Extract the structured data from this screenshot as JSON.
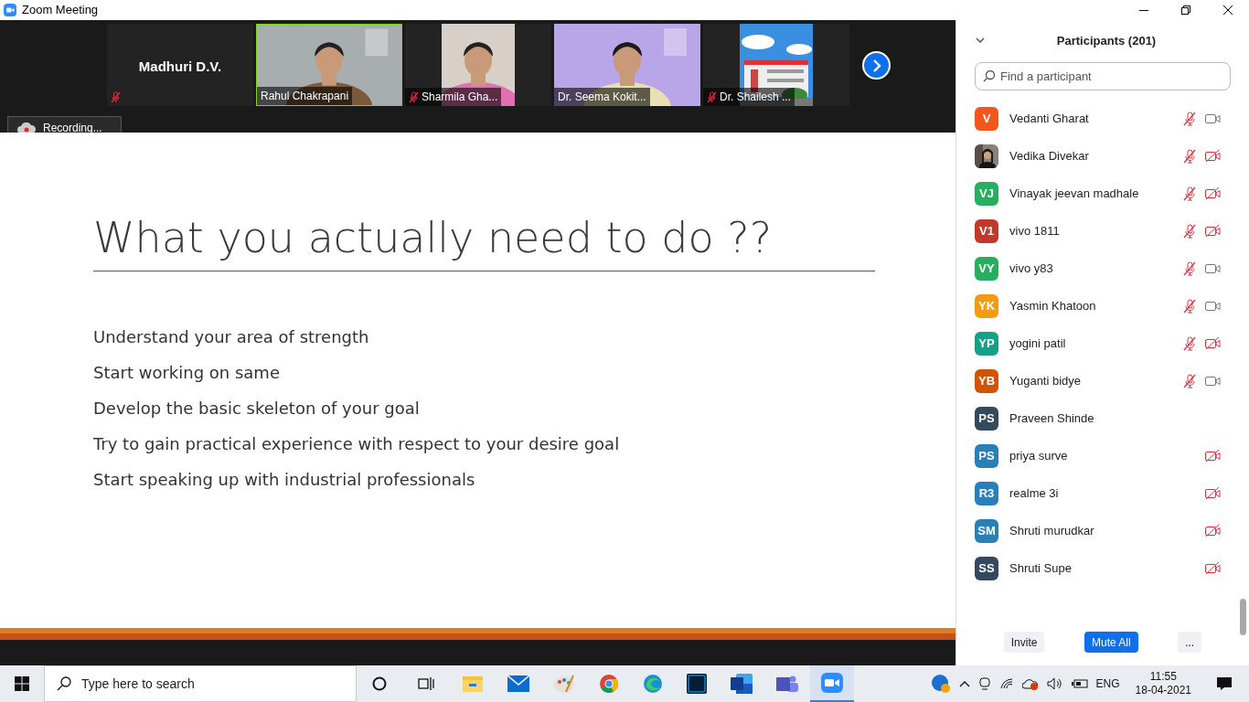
{
  "window": {
    "title": "Zoom Meeting"
  },
  "video_strip": {
    "tiles": [
      {
        "kind": "name",
        "name": "Madhuri D.V.",
        "muted": true,
        "selected": false
      },
      {
        "kind": "video",
        "name": "Rahul Chakrapani",
        "muted": false,
        "selected": true
      },
      {
        "kind": "video",
        "name": "Sharmila Gha...",
        "muted": true,
        "selected": false
      },
      {
        "kind": "video",
        "name": "Dr. Seema Kokit...",
        "muted": false,
        "selected": false
      },
      {
        "kind": "video",
        "name": "Dr. Shailesh ...",
        "muted": true,
        "selected": false
      }
    ]
  },
  "recording": {
    "label": "Recording..."
  },
  "slide": {
    "title": "What you actually need to do ??",
    "bullets": [
      "Understand your area of strength",
      "Start working on same",
      "Develop the basic skeleton of your goal",
      "Try to gain practical experience with respect to your desire goal",
      "Start speaking up with industrial professionals"
    ]
  },
  "participants": {
    "title": "Participants (201)",
    "search_placeholder": "Find a participant",
    "items": [
      {
        "name": "Vedanti Gharat",
        "kind": "initials",
        "initials": "V",
        "color": "#f2561d",
        "muted": true,
        "video_off": false
      },
      {
        "name": "Vedika Divekar",
        "muted": true,
        "video_off": true
      },
      {
        "name": "Vinayak jeevan madhale",
        "kind": "initials",
        "initials": "VJ",
        "color": "#27ae60",
        "muted": true,
        "video_off": true
      },
      {
        "name": "vivo 1811",
        "kind": "initials",
        "initials": "V1",
        "color": "#c0392b",
        "muted": true,
        "video_off": true
      },
      {
        "name": "vivo y83",
        "kind": "initials",
        "initials": "VY",
        "color": "#27ae60",
        "muted": true,
        "video_off": false
      },
      {
        "name": "Yasmin Khatoon",
        "kind": "initials",
        "initials": "YK",
        "color": "#f39c12",
        "muted": true,
        "video_off": false
      },
      {
        "name": "yogini patil",
        "kind": "initials",
        "initials": "YP",
        "color": "#16a085",
        "muted": true,
        "video_off": true
      },
      {
        "name": "Yuganti bidye",
        "kind": "initials",
        "initials": "YB",
        "color": "#d35400",
        "muted": true,
        "video_off": false
      },
      {
        "name": "Praveen Shinde",
        "kind": "initials",
        "initials": "PS",
        "color": "#34495e",
        "muted": false
      },
      {
        "name": "priya surve",
        "kind": "initials",
        "initials": "PS",
        "color": "#2980b9",
        "muted": false,
        "video_off": true
      },
      {
        "name": "realme 3i",
        "kind": "initials",
        "initials": "R3",
        "color": "#2980b9",
        "muted": false,
        "video_off": true
      },
      {
        "name": "Shruti murudkar",
        "kind": "initials",
        "initials": "SM",
        "color": "#2980b9",
        "muted": false,
        "video_off": true
      },
      {
        "name": "Shruti Supe",
        "kind": "initials",
        "initials": "SS",
        "color": "#34495e",
        "muted": false,
        "video_off": true
      }
    ],
    "buttons": [
      {
        "label": "Invite",
        "kind": "plain"
      },
      {
        "label": "Mute All",
        "kind": "primary"
      },
      {
        "label": "...",
        "kind": "plain"
      }
    ]
  },
  "taskbar": {
    "search_placeholder": "Type here to search",
    "language": "ENG",
    "time": "11:55",
    "date": "18-04-2021"
  }
}
